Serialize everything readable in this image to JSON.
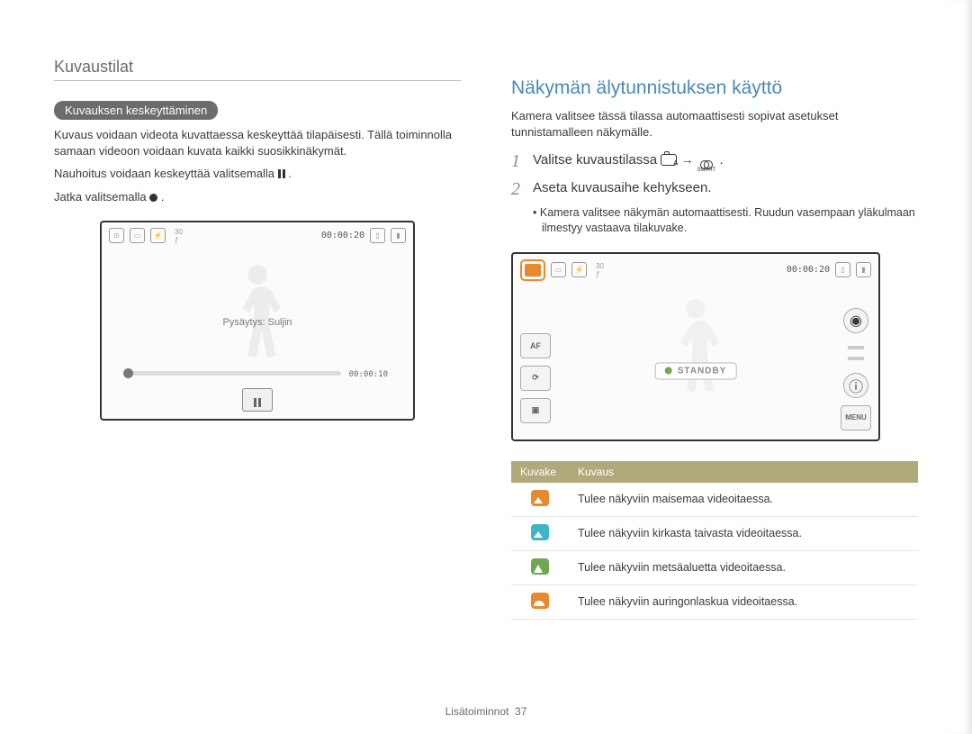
{
  "breadcrumb": "Kuvaustilat",
  "left": {
    "pill": "Kuvauksen keskeyttäminen",
    "p1": "Kuvaus voidaan videota kuvattaessa keskeyttää tilapäisesti. Tällä toiminnolla samaan videoon voidaan kuvata kaikki suosikkinäkymät.",
    "p2a": "Nauhoitus voidaan keskeyttää valitsemalla ",
    "p2b": ".",
    "p3a": "Jatka valitsemalla ",
    "p3b": ".",
    "screen": {
      "top_time": "00:00:20",
      "pys_label": "Pysäytys: Suljin",
      "elapsed": "00:00:10"
    }
  },
  "right": {
    "h2": "Näkymän älytunnistuksen käyttö",
    "intro": "Kamera valitsee tässä tilassa automaattisesti sopivat asetukset tunnistamalleen näkymälle.",
    "step1_num": "1",
    "step1_a": "Valitse kuvaustilassa ",
    "step1_b": " → ",
    "step1_c": ".",
    "step2_num": "2",
    "step2": "Aseta kuvausaihe kehykseen.",
    "sub": "Kamera valitsee näkymän automaattisesti. Ruudun vasempaan yläkulmaan ilmestyy vastaava tilakuvake.",
    "screen": {
      "top_time": "00:00:20",
      "af": "AF",
      "standby": "STANDBY",
      "menu": "MENU"
    },
    "table": {
      "head_icon": "Kuvake",
      "head_desc": "Kuvaus",
      "rows": [
        {
          "icon": "mountain",
          "desc": "Tulee näkyviin maisemaa videoitaessa."
        },
        {
          "icon": "sky",
          "desc": "Tulee näkyviin kirkasta taivasta videoitaessa."
        },
        {
          "icon": "forest",
          "desc": "Tulee näkyviin metsäaluetta videoitaessa."
        },
        {
          "icon": "sunset",
          "desc": "Tulee näkyviin auringonlaskua videoitaessa."
        }
      ]
    }
  },
  "footer": {
    "label": "Lisätoiminnot",
    "page": "37"
  }
}
